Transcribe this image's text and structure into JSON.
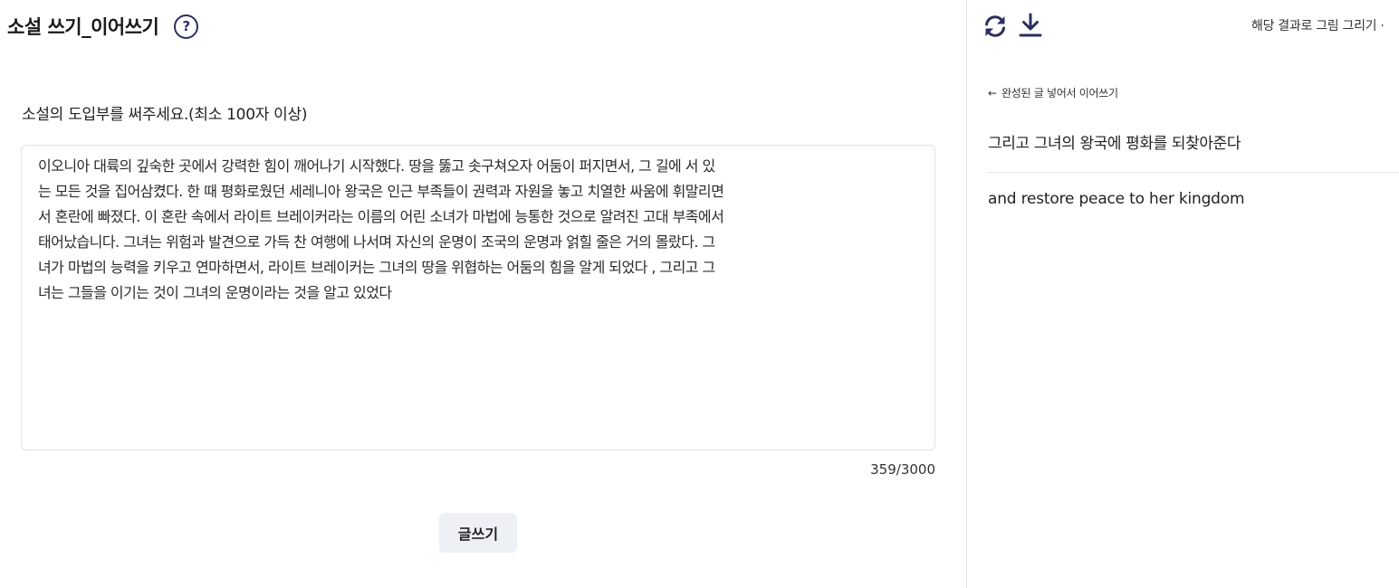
{
  "header": {
    "title": "소설 쓰기_이어쓰기",
    "help_icon": "?"
  },
  "editor": {
    "prompt_label": "소설의 도입부를 써주세요.(최소 100자 이상)",
    "text": "이오니아 대륙의 깊숙한 곳에서 강력한 힘이 깨어나기 시작했다. 땅을 뚫고 솟구쳐오자 어둠이 퍼지면서, 그 길에 서 있\n는 모든 것을 집어삼켰다. 한 때 평화로웠던 세레니아 왕국은 인근 부족들이 권력과 자원을 놓고 치열한 싸움에 휘말리면\n서 혼란에 빠졌다. 이 혼란 속에서 라이트 브레이커라는 이름의 어린 소녀가 마법에 능통한 것으로 알려진 고대 부족에서\n태어났습니다. 그녀는 위험과 발견으로 가득 찬 여행에 나서며 자신의 운명이 조국의 운명과 얽힐 줄은 거의 몰랐다. 그\n녀가 마법의 능력을 키우고 연마하면서, 라이트 브레이커는 그녀의 땅을 위협하는 어둠의 힘을 알게 되었다 , 그리고 그\n녀는 그들을 이기는 것이 그녀의 운명이라는 것을 알고 있었다",
    "char_count": "359/3000",
    "submit_label": "글쓰기"
  },
  "result": {
    "icons": [
      "refresh-icon",
      "download-icon"
    ],
    "draw_link_label": "해당 결과로 그림 그리기 ·",
    "back_arrow": "←",
    "back_label": "완성된 글 넣어서 이어쓰기",
    "korean_text": "그리고 그녀의 왕국에 평화를 되찾아준다",
    "english_text": "and restore peace to her kingdom"
  },
  "colors": {
    "accent_icon": "#2b2f5e",
    "button_bg": "#edf1f5",
    "border": "#e2e2e6"
  }
}
